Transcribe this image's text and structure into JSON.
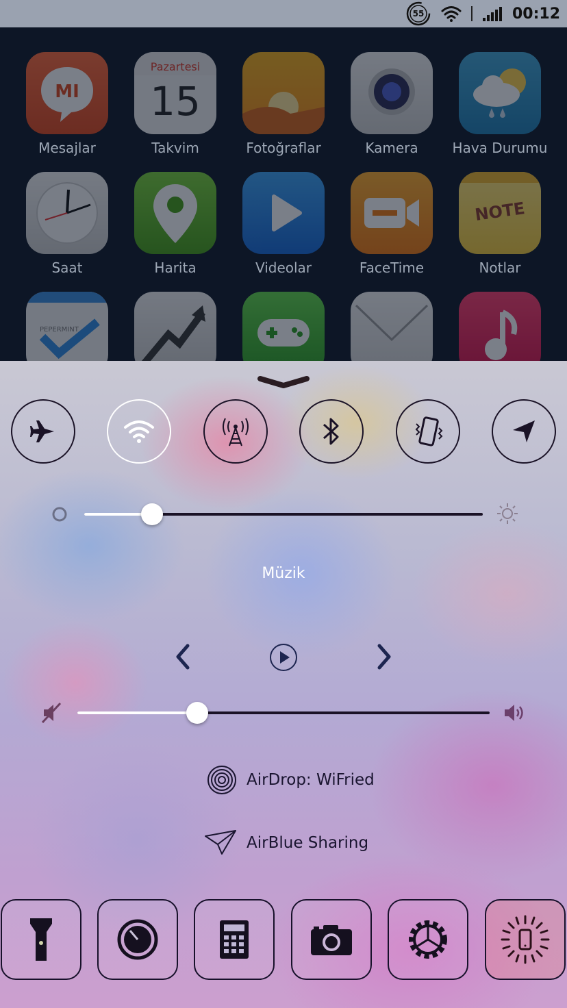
{
  "status_bar": {
    "battery_badge": "55",
    "time": "00:12"
  },
  "home": {
    "apps": [
      {
        "label": "Mesajlar",
        "icon": "mi-messages-icon"
      },
      {
        "label": "Takvim",
        "icon": "calendar-icon",
        "day_name": "Pazartesi",
        "day_number": "15"
      },
      {
        "label": "Fotoğraflar",
        "icon": "photos-icon"
      },
      {
        "label": "Kamera",
        "icon": "camera-icon"
      },
      {
        "label": "Hava Durumu",
        "icon": "weather-icon"
      },
      {
        "label": "Saat",
        "icon": "clock-icon"
      },
      {
        "label": "Harita",
        "icon": "map-pin-icon"
      },
      {
        "label": "Videolar",
        "icon": "video-play-icon"
      },
      {
        "label": "FaceTime",
        "icon": "facetime-icon"
      },
      {
        "label": "Notlar",
        "icon": "notes-icon",
        "note_text": "NOTE"
      },
      {
        "label": "",
        "icon": "reminders-icon",
        "reminder_text": "PEPERMINT"
      },
      {
        "label": "",
        "icon": "stocks-icon"
      },
      {
        "label": "",
        "icon": "games-icon"
      },
      {
        "label": "",
        "icon": "mail-icon"
      },
      {
        "label": "",
        "icon": "music-icon"
      }
    ]
  },
  "control_center": {
    "toggles": [
      {
        "name": "airplane-mode",
        "icon": "airplane-icon",
        "on": false
      },
      {
        "name": "wifi",
        "icon": "wifi-icon",
        "on": true
      },
      {
        "name": "hotspot",
        "icon": "antenna-icon",
        "on": false
      },
      {
        "name": "bluetooth",
        "icon": "bluetooth-icon",
        "on": false
      },
      {
        "name": "vibrate",
        "icon": "vibrate-phone-icon",
        "on": false
      },
      {
        "name": "location",
        "icon": "location-arrow-icon",
        "on": false
      }
    ],
    "brightness": {
      "value": 0.17,
      "min_icon": "brightness-low-icon",
      "max_icon": "brightness-high-icon"
    },
    "music": {
      "title": "Müzik"
    },
    "volume": {
      "value": 0.29,
      "min_icon": "mute-icon",
      "max_icon": "speaker-icon"
    },
    "airdrop": {
      "label": "AirDrop: WiFried",
      "icon": "airdrop-icon"
    },
    "airblue": {
      "label": "AirBlue Sharing",
      "icon": "paper-plane-icon"
    },
    "shortcuts": [
      {
        "name": "flashlight",
        "icon": "flashlight-icon"
      },
      {
        "name": "timer",
        "icon": "timer-icon"
      },
      {
        "name": "calculator",
        "icon": "calculator-icon"
      },
      {
        "name": "camera",
        "icon": "camera-icon"
      },
      {
        "name": "settings",
        "icon": "gear-icon"
      },
      {
        "name": "respring",
        "icon": "phone-spinner-icon"
      }
    ]
  },
  "colors": {
    "control_dark": "#1a1226",
    "home_bg": "#0d1626",
    "status_bar_bg": "#9aa2b0"
  }
}
